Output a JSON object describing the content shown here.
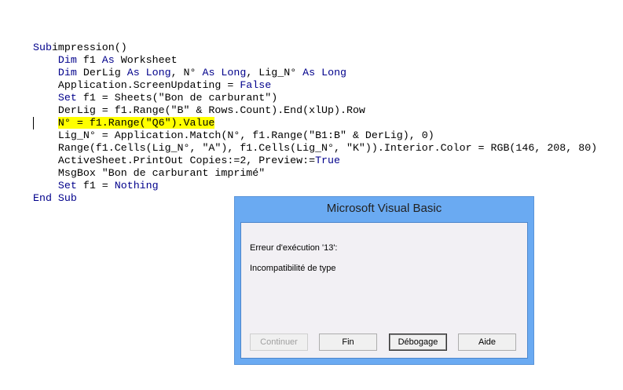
{
  "code": {
    "highlight_line": 6,
    "lines": [
      [
        [
          "kw",
          "Sub"
        ],
        [
          "",
          "impression()"
        ]
      ],
      [
        [
          "",
          "    "
        ],
        [
          "kw",
          "Dim"
        ],
        [
          "",
          " f1 "
        ],
        [
          "kw",
          "As"
        ],
        [
          "",
          " Worksheet"
        ]
      ],
      [
        [
          "",
          "    "
        ],
        [
          "kw",
          "Dim"
        ],
        [
          "",
          " DerLig "
        ],
        [
          "kw",
          "As Long"
        ],
        [
          "",
          ", N° "
        ],
        [
          "kw",
          "As Long"
        ],
        [
          "",
          ", Lig_N° "
        ],
        [
          "kw",
          "As Long"
        ]
      ],
      [
        [
          "",
          "    Application.ScreenUpdating = "
        ],
        [
          "kw",
          "False"
        ]
      ],
      [
        [
          "",
          "    "
        ],
        [
          "kw",
          "Set"
        ],
        [
          "",
          " f1 = Sheets(\"Bon de carburant\")"
        ]
      ],
      [
        [
          "",
          "    DerLig = f1.Range(\"B\" & Rows.Count).End(xlUp).Row"
        ]
      ],
      [
        [
          "",
          "    "
        ],
        [
          "hl",
          "N° = f1.Range(\"Q6\").Value"
        ]
      ],
      [
        [
          "",
          "    Lig_N° = Application.Match(N°, f1.Range(\"B1:B\" & DerLig), 0)"
        ]
      ],
      [
        [
          "",
          "    Range(f1.Cells(Lig_N°, \"A\"), f1.Cells(Lig_N°, \"K\")).Interior.Color = RGB(146, 208, 80)"
        ]
      ],
      [
        [
          "",
          "    ActiveSheet.PrintOut Copies:=2, Preview:="
        ],
        [
          "kw",
          "True"
        ]
      ],
      [
        [
          "",
          "    MsgBox \"Bon de carburant imprimé\""
        ]
      ],
      [
        [
          "",
          "    "
        ],
        [
          "kw",
          "Set"
        ],
        [
          "",
          " f1 = "
        ],
        [
          "kw",
          "Nothing"
        ]
      ],
      [
        [
          "kw",
          "End Sub"
        ]
      ]
    ]
  },
  "dialog": {
    "title": "Microsoft Visual Basic",
    "error_label": "Erreur d'exécution '13':",
    "error_message": "Incompatibilité de type",
    "buttons": {
      "continue": "Continuer",
      "end": "Fin",
      "debug": "Débogage",
      "help": "Aide"
    }
  }
}
